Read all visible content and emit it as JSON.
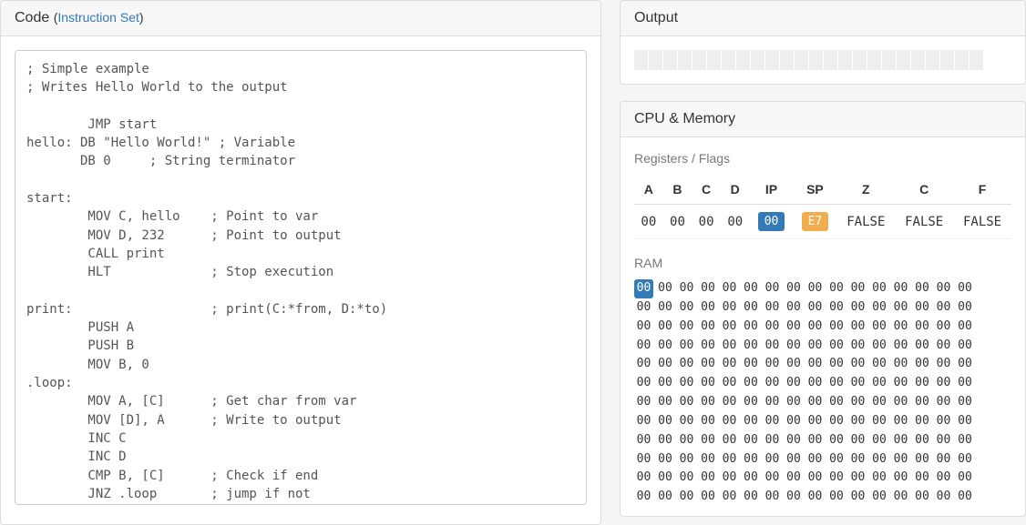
{
  "code": {
    "title": "Code",
    "instruction_set_link": "Instruction Set",
    "source": "; Simple example\n; Writes Hello World to the output\n\n        JMP start\nhello: DB \"Hello World!\" ; Variable\n       DB 0     ; String terminator\n\nstart:\n        MOV C, hello    ; Point to var\n        MOV D, 232      ; Point to output\n        CALL print\n        HLT             ; Stop execution\n\nprint:                  ; print(C:*from, D:*to)\n        PUSH A\n        PUSH B\n        MOV B, 0\n.loop:\n        MOV A, [C]      ; Get char from var\n        MOV [D], A      ; Write to output\n        INC C\n        INC D\n        CMP B, [C]      ; Check if end\n        JNZ .loop       ; jump if not"
  },
  "output": {
    "title": "Output",
    "cell_count": 24
  },
  "cpu": {
    "title": "CPU & Memory",
    "registers_label": "Registers / Flags",
    "headers": [
      "A",
      "B",
      "C",
      "D",
      "IP",
      "SP",
      "Z",
      "C",
      "F"
    ],
    "values": {
      "A": "00",
      "B": "00",
      "C": "00",
      "D": "00",
      "IP": "00",
      "SP": "E7",
      "Z": "FALSE",
      "Cflag": "FALSE",
      "F": "FALSE"
    },
    "ram_label": "RAM",
    "ram_rows": 12,
    "ram_cols": 16,
    "ram_default": "00",
    "ram_highlight_index": 0
  }
}
